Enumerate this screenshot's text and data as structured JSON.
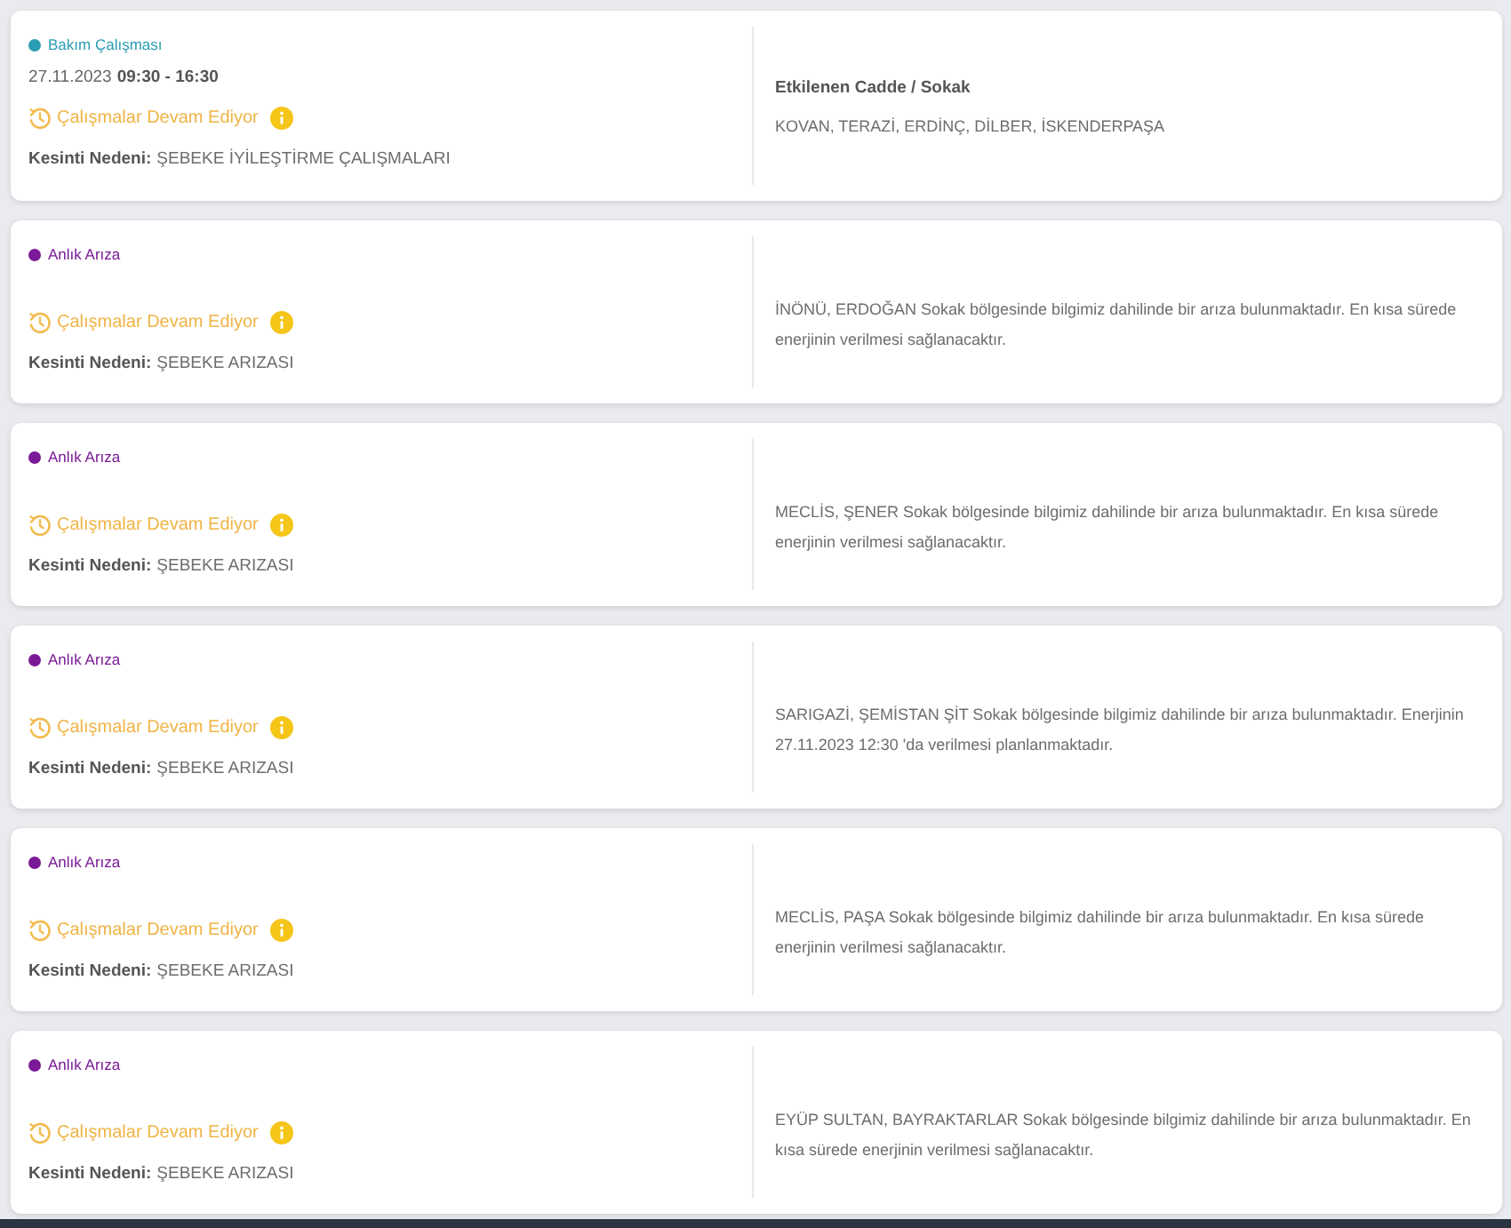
{
  "outages": [
    {
      "kind": "maintenance",
      "category": "Bakım Çalışması",
      "color": "#2a9db5",
      "date": "27.11.2023",
      "time": "09:30 - 16:30",
      "status": "Çalışmalar Devam Ediyor",
      "reason_label": "Kesinti Nedeni:",
      "reason": "ŞEBEKE İYİLEŞTİRME ÇALIŞMALARI",
      "streets_heading": "Etkilenen Cadde / Sokak",
      "streets": "KOVAN, TERAZİ, ERDİNÇ, DİLBER, İSKENDERPAŞA"
    },
    {
      "kind": "fault",
      "category": "Anlık Arıza",
      "color": "#7a1a96",
      "status": "Çalışmalar Devam Ediyor",
      "reason_label": "Kesinti Nedeni:",
      "reason": "ŞEBEKE ARIZASI",
      "description": "İNÖNÜ, ERDOĞAN Sokak bölgesinde bilgimiz dahilinde bir arıza bulunmaktadır. En kısa sürede enerjinin verilmesi sağlanacaktır."
    },
    {
      "kind": "fault",
      "category": "Anlık Arıza",
      "color": "#7a1a96",
      "status": "Çalışmalar Devam Ediyor",
      "reason_label": "Kesinti Nedeni:",
      "reason": "ŞEBEKE ARIZASI",
      "description": "MECLİS, ŞENER Sokak bölgesinde bilgimiz dahilinde bir arıza bulunmaktadır. En kısa sürede enerjinin verilmesi sağlanacaktır."
    },
    {
      "kind": "fault",
      "category": "Anlık Arıza",
      "color": "#7a1a96",
      "status": "Çalışmalar Devam Ediyor",
      "reason_label": "Kesinti Nedeni:",
      "reason": "ŞEBEKE ARIZASI",
      "description": "SARIGAZİ, ŞEMİSTAN ŞİT Sokak bölgesinde bilgimiz dahilinde bir arıza bulunmaktadır. Enerjinin 27.11.2023 12:30 'da verilmesi planlanmaktadır."
    },
    {
      "kind": "fault",
      "category": "Anlık Arıza",
      "color": "#7a1a96",
      "status": "Çalışmalar Devam Ediyor",
      "reason_label": "Kesinti Nedeni:",
      "reason": "ŞEBEKE ARIZASI",
      "description": "MECLİS, PAŞA Sokak bölgesinde bilgimiz dahilinde bir arıza bulunmaktadır. En kısa sürede enerjinin verilmesi sağlanacaktır."
    },
    {
      "kind": "fault",
      "category": "Anlık Arıza",
      "color": "#7a1a96",
      "status": "Çalışmalar Devam Ediyor",
      "reason_label": "Kesinti Nedeni:",
      "reason": "ŞEBEKE ARIZASI",
      "description": "EYÜP SULTAN, BAYRAKTARLAR Sokak bölgesinde bilgimiz dahilinde bir arıza bulunmaktadır. En kısa sürede enerjinin verilmesi sağlanacaktır."
    }
  ]
}
